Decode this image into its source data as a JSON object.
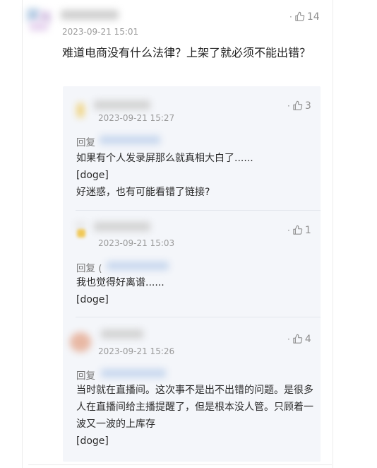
{
  "main_comment": {
    "time": "2023-09-21 15:01",
    "likes": "14",
    "text": "难道电商没有什么法律？上架了就必须不能出错？"
  },
  "replies": [
    {
      "time": "2023-09-21 15:27",
      "likes": "3",
      "reply_prefix": "回复",
      "lines": [
        "如果有个人发录屏那么就真相大白了......",
        "[doge]",
        "好迷惑，也有可能看错了链接?"
      ]
    },
    {
      "time": "2023-09-21 15:03",
      "likes": "1",
      "reply_prefix": "回复 (",
      "lines": [
        "我也觉得好离谱......",
        "[doge]"
      ]
    },
    {
      "time": "2023-09-21 15:26",
      "likes": "4",
      "reply_prefix": "回复",
      "lines": [
        "当时就在直播间。这次事不是出不出错的问题。是很多人在直播间给主播提醒了，但是根本没人管。只顾着一波又一波的上库存",
        "[doge]"
      ]
    }
  ],
  "icons": {
    "like": "thumbs-up-icon"
  },
  "colors": {
    "panel": "#f4f6fa",
    "muted": "#9a9a9a"
  }
}
